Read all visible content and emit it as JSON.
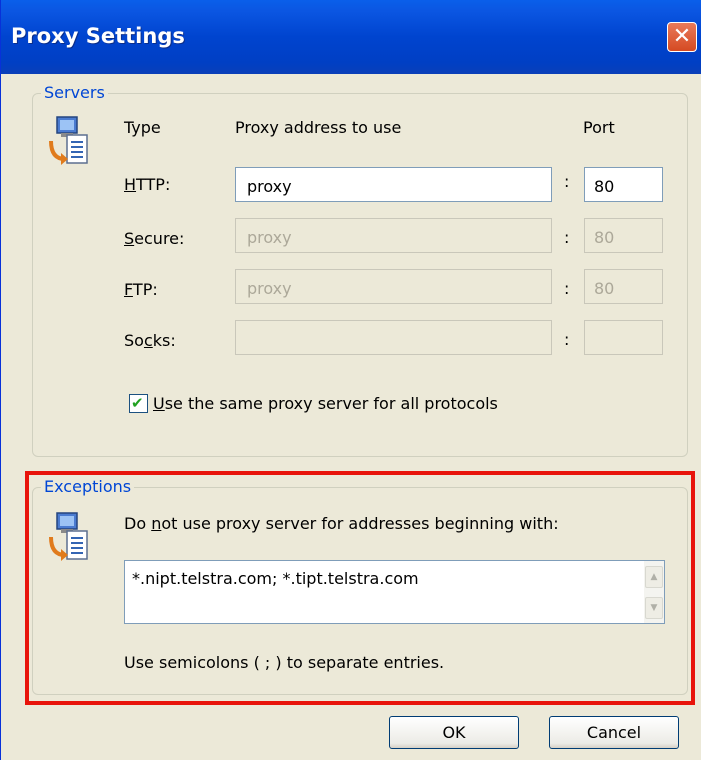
{
  "window": {
    "title": "Proxy Settings",
    "close_glyph": "✕"
  },
  "servers": {
    "legend": "Servers",
    "icon": "network-computer-icon",
    "headers": {
      "type": "Type",
      "address": "Proxy address to use",
      "port": "Port"
    },
    "rows": [
      {
        "pre": "",
        "mnemonic": "H",
        "post": "TTP:",
        "address": "proxy",
        "port": "80",
        "enabled": true
      },
      {
        "pre": "",
        "mnemonic": "S",
        "post": "ecure:",
        "address": "proxy",
        "port": "80",
        "enabled": false
      },
      {
        "pre": "",
        "mnemonic": "F",
        "post": "TP:",
        "address": "proxy",
        "port": "80",
        "enabled": false
      },
      {
        "pre": "So",
        "mnemonic": "c",
        "post": "ks:",
        "address": "",
        "port": "",
        "enabled": false
      }
    ],
    "colon": ":",
    "same_proxy": {
      "mnemonic": "U",
      "rest": "se the same proxy server for all protocols",
      "checked": true,
      "check_glyph": "✔"
    }
  },
  "exceptions": {
    "legend": "Exceptions",
    "icon": "network-computer-icon",
    "label_pre": "Do ",
    "label_mnemonic": "n",
    "label_post": "ot use proxy server for addresses beginning with:",
    "value": "*.nipt.telstra.com; *.tipt.telstra.com",
    "hint": "Use semicolons ( ; ) to separate entries.",
    "scroll_up": "▲",
    "scroll_down": "▼"
  },
  "buttons": {
    "ok": "OK",
    "cancel": "Cancel"
  },
  "colors": {
    "titlebar": "#0044CF",
    "legend": "#0046D5",
    "highlight": "#E8140B",
    "dialog_bg": "#ECE9D8"
  }
}
